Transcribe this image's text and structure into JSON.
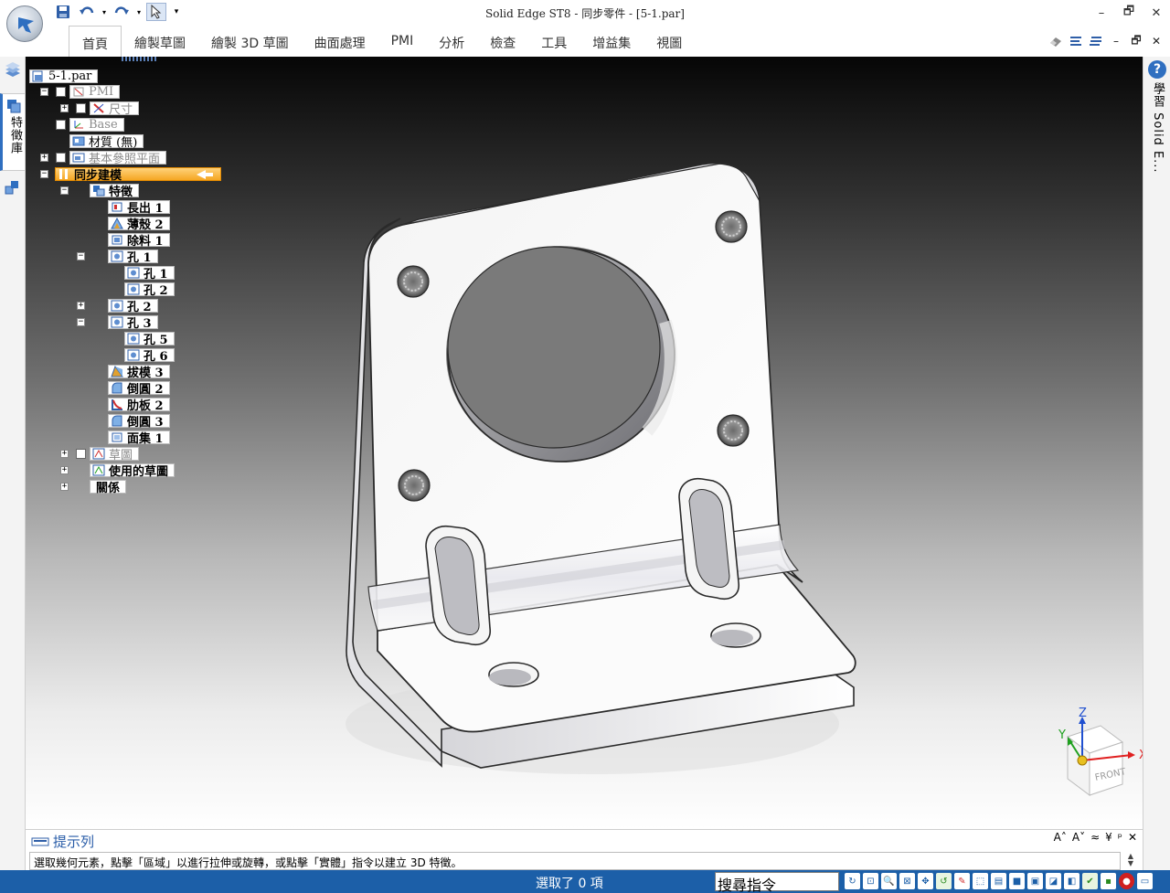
{
  "window": {
    "title": "Solid Edge ST8 - 同步零件 - [5-1.par]",
    "controls": [
      "–",
      "🗗",
      "✕"
    ]
  },
  "quick_access": {
    "save": "save-icon",
    "undo": "undo-icon",
    "redo": "redo-icon",
    "select": "select-arrow-icon",
    "customize": "▾"
  },
  "ribbon": {
    "tabs": [
      "首頁",
      "繪製草圖",
      "繪製 3D 草圖",
      "曲面處理",
      "PMI",
      "分析",
      "檢查",
      "工具",
      "增益集",
      "視圖"
    ],
    "active_tab": "首頁",
    "right_controls": [
      "–",
      "🗗",
      "✕"
    ]
  },
  "left_strip": {
    "tab_label": "特徵庫"
  },
  "right_strip": {
    "tab_label": "學習 Solid E..."
  },
  "tree": {
    "root": "5-1.par",
    "pmi": "PMI",
    "dimensions": "尺寸",
    "base": "Base",
    "material": "材質 (無)",
    "ref_planes": "基本參照平面",
    "sync_modeling": "同步建模",
    "features": "特徵",
    "protrusion1": "長出 1",
    "thinwall2": "薄殼 2",
    "cutout1": "除料 1",
    "hole1": "孔 1",
    "hole1_1": "孔 1",
    "hole1_2": "孔 2",
    "hole2": "孔 2",
    "hole3": "孔 3",
    "hole3_5": "孔 5",
    "hole3_6": "孔 6",
    "draft3": "拔模 3",
    "round2": "倒圓 2",
    "rib2": "肋板 2",
    "round3": "倒圓 3",
    "faceset1": "面集 1",
    "sketches": "草圖",
    "used_sketches": "使用的草圖",
    "relations": "關係"
  },
  "prompt_bar": {
    "title": "提示列",
    "text": "選取幾何元素，點擊「區域」以進行拉伸或旋轉，或點擊「實體」指令以建立 3D 特徵。",
    "controls": [
      "A˄",
      "A˅",
      "≈",
      "¥",
      "ᵖ",
      "✕"
    ]
  },
  "status_bar": {
    "selection": "選取了 0 項",
    "command_search": "搜尋指令"
  },
  "triad": {
    "x": "X",
    "y": "Y",
    "z": "Z",
    "face": "FRONT"
  },
  "colors": {
    "status_bar": "#1c5fa8",
    "selection_highlight": "#f5a623",
    "axis_x": "#e02020",
    "axis_y": "#20a020",
    "axis_z": "#2050d0"
  }
}
